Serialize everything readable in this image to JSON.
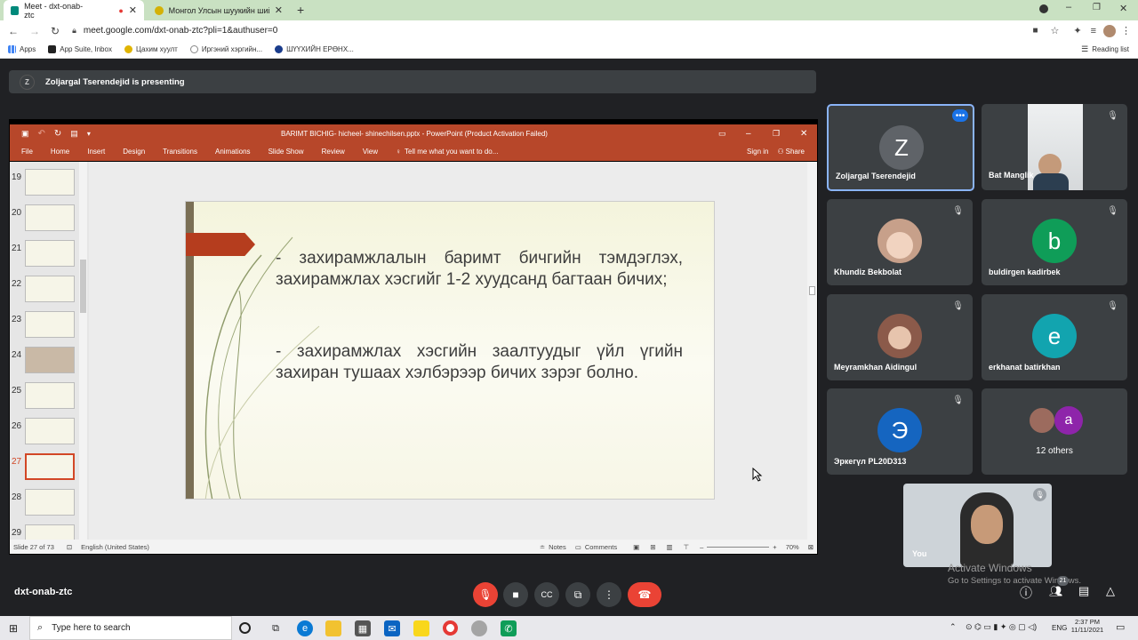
{
  "browser": {
    "tabs": [
      {
        "title": "Meet - dxt-onab-ztc",
        "active": true
      },
      {
        "title": "Монгол Улсын шуукийн шийдвэ",
        "active": false
      }
    ],
    "url": "meet.google.com/dxt-onab-ztc?pli=1&authuser=0",
    "bookmarks": [
      "Apps",
      "App Suite, Inbox",
      "Цахим хуулт",
      "Иргэний хэргийн...",
      "ШҮҮХИЙН ЕРӨНХ..."
    ],
    "reading_list": "Reading list"
  },
  "meet": {
    "presenter_initial": "Z",
    "presenting_text": "Zoljargal Tserendejid is presenting",
    "meeting_code": "dxt-onab-ztc",
    "participants_badge": "21",
    "tiles": [
      {
        "name": "Zoljargal Tserendejid",
        "initial": "Z",
        "color": "#5f6368",
        "more_icon": "more-icon"
      },
      {
        "name": "Bat Manglik",
        "initial": "",
        "color": "#dfe3e6"
      },
      {
        "name": "Khundiz Bekbolat",
        "initial": "",
        "color": "#c7a08a"
      },
      {
        "name": "buldirgen kadirbek",
        "initial": "b",
        "color": "#0f9d58"
      },
      {
        "name": "Meyramkhan Aidingul",
        "initial": "",
        "color": "#8b5a4a"
      },
      {
        "name": "erkhanat batirkhan",
        "initial": "e",
        "color": "#12a4af"
      },
      {
        "name": "Эркегүл PL20D313",
        "initial": "Э",
        "color": "#1565c0"
      },
      {
        "name": "12 others",
        "initial": "a",
        "color": "#8e24aa"
      }
    ],
    "self_label": "You",
    "watermark_title": "Activate Windows",
    "watermark_sub": "Go to Settings to activate Windows."
  },
  "powerpoint": {
    "title": "BARIMT BICHIG- hicheel- shinechilsen.pptx - PowerPoint (Product Activation Failed)",
    "menu": [
      "File",
      "Home",
      "Insert",
      "Design",
      "Transitions",
      "Animations",
      "Slide Show",
      "Review",
      "View"
    ],
    "tell_me": "Tell me what you want to do...",
    "sign_in": "Sign in",
    "share": "Share",
    "thumbnails": [
      "19",
      "20",
      "21",
      "22",
      "23",
      "24",
      "25",
      "26",
      "27",
      "28",
      "29"
    ],
    "selected_thumbnail": "27",
    "slide_text_1": "- захирамжлалын баримт бичгийн тэмдэглэх, захирамжлах хэсгийг 1-2 хуудсанд багтаан бичих;",
    "slide_text_2": "- захирамжлах хэсгийн заалтуудыг үйл үгийн захиран тушаах хэлбэрээр бичих зэрэг болно.",
    "status_slide": "Slide 27 of 73",
    "status_lang": "English (United States)",
    "status_notes": "Notes",
    "status_comments": "Comments",
    "zoom": "70%"
  },
  "taskbar": {
    "search_placeholder": "Type here to search",
    "lang": "ENG",
    "time": "2:37 PM",
    "date": "11/11/2021"
  }
}
